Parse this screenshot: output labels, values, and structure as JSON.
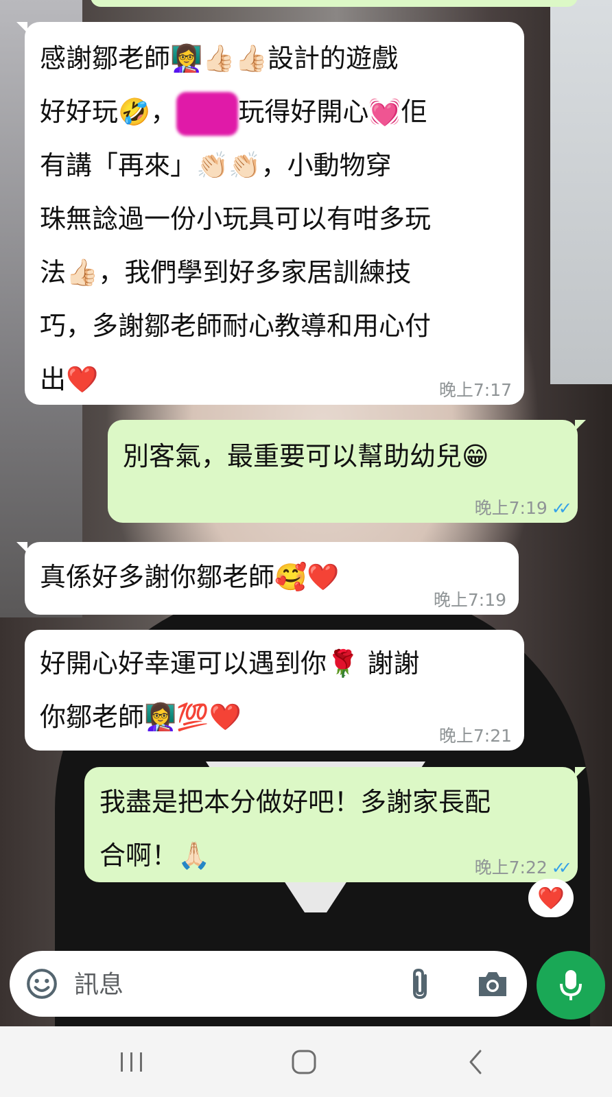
{
  "messages": [
    {
      "direction": "incoming",
      "lines": [
        "感謝鄒老師👩‍🏫👍🏻👍🏻設計的遊戲",
        "好好玩🤣，",
        "有講「再來」👏🏻👏🏻，小動物穿",
        "珠無諗過一份小玩具可以有咁多玩",
        "法👍🏻，我們學到好多家居訓練技",
        "巧，多謝鄒老師耐心教導和用心付",
        "出❤️"
      ],
      "line2_after_redaction": "玩得好開心💓佢",
      "time": "晚上7:17"
    },
    {
      "direction": "outgoing",
      "lines": [
        "別客氣，最重要可以幫助幼兒😁"
      ],
      "time": "晚上7:19",
      "ticks": "✓✓"
    },
    {
      "direction": "incoming",
      "lines": [
        "真係好多謝你鄒老師🥰❤️"
      ],
      "time": "晚上7:19"
    },
    {
      "direction": "incoming",
      "lines": [
        "好開心好幸運可以遇到你🌹 謝謝",
        "你鄒老師👩‍🏫💯❤️"
      ],
      "time": "晚上7:21"
    },
    {
      "direction": "outgoing",
      "lines": [
        "我盡是把本分做好吧！多謝家長配",
        "合啊！🙏🏻"
      ],
      "time": "晚上7:22",
      "ticks": "✓✓"
    }
  ],
  "reaction": "❤️",
  "composer": {
    "placeholder": "訊息"
  },
  "colors": {
    "incoming": "#ffffff",
    "outgoing": "#dcf8c6",
    "ticks": "#34a0e8",
    "mic": "#1aa856"
  },
  "icons": [
    "emoji-icon",
    "paperclip-icon",
    "camera-icon",
    "microphone-icon",
    "recent-apps-icon",
    "home-icon",
    "back-icon"
  ]
}
